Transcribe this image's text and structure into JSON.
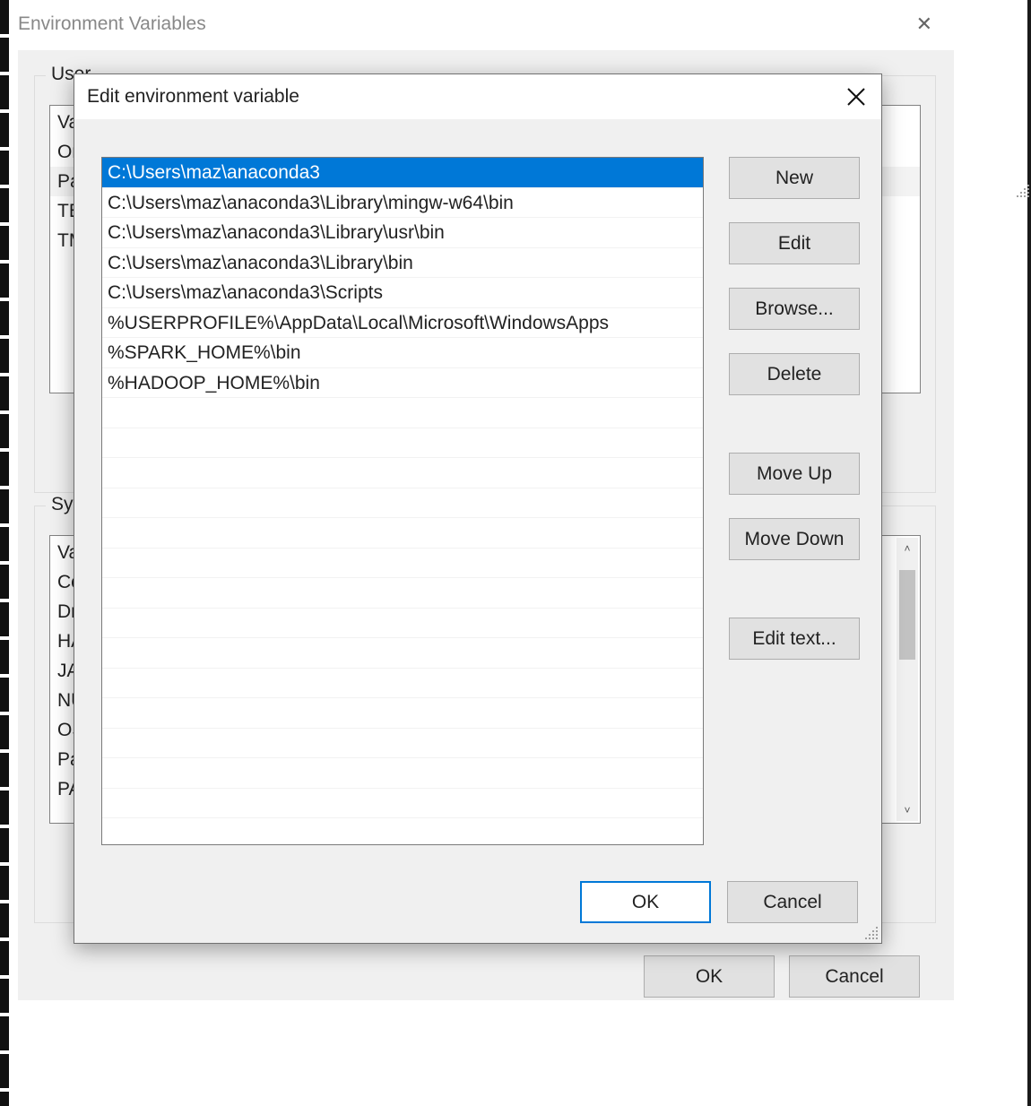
{
  "parent": {
    "title": "Environment Variables",
    "user_label_prefix": "User",
    "user_header": "Va",
    "user_rows": [
      "On",
      "Pat",
      "TE",
      "TM"
    ],
    "sys_label_prefix": "Syste",
    "sys_header": "Va",
    "sys_rows": [
      "Co",
      "Dri",
      "HA",
      "JA",
      "NU",
      "OS",
      "Pat",
      "PA"
    ],
    "ok_label": "OK",
    "cancel_label": "Cancel",
    "scroll_up_glyph": "˄",
    "scroll_down_glyph": "˅"
  },
  "modal": {
    "title": "Edit environment variable",
    "path_entries": [
      "C:\\Users\\maz\\anaconda3",
      "C:\\Users\\maz\\anaconda3\\Library\\mingw-w64\\bin",
      "C:\\Users\\maz\\anaconda3\\Library\\usr\\bin",
      "C:\\Users\\maz\\anaconda3\\Library\\bin",
      "C:\\Users\\maz\\anaconda3\\Scripts",
      "%USERPROFILE%\\AppData\\Local\\Microsoft\\WindowsApps",
      "%SPARK_HOME%\\bin",
      "%HADOOP_HOME%\\bin"
    ],
    "selected_index": 0,
    "buttons": {
      "new": "New",
      "edit": "Edit",
      "browse": "Browse...",
      "delete": "Delete",
      "move_up": "Move Up",
      "move_down": "Move Down",
      "edit_text": "Edit text..."
    },
    "ok_label": "OK",
    "cancel_label": "Cancel"
  }
}
